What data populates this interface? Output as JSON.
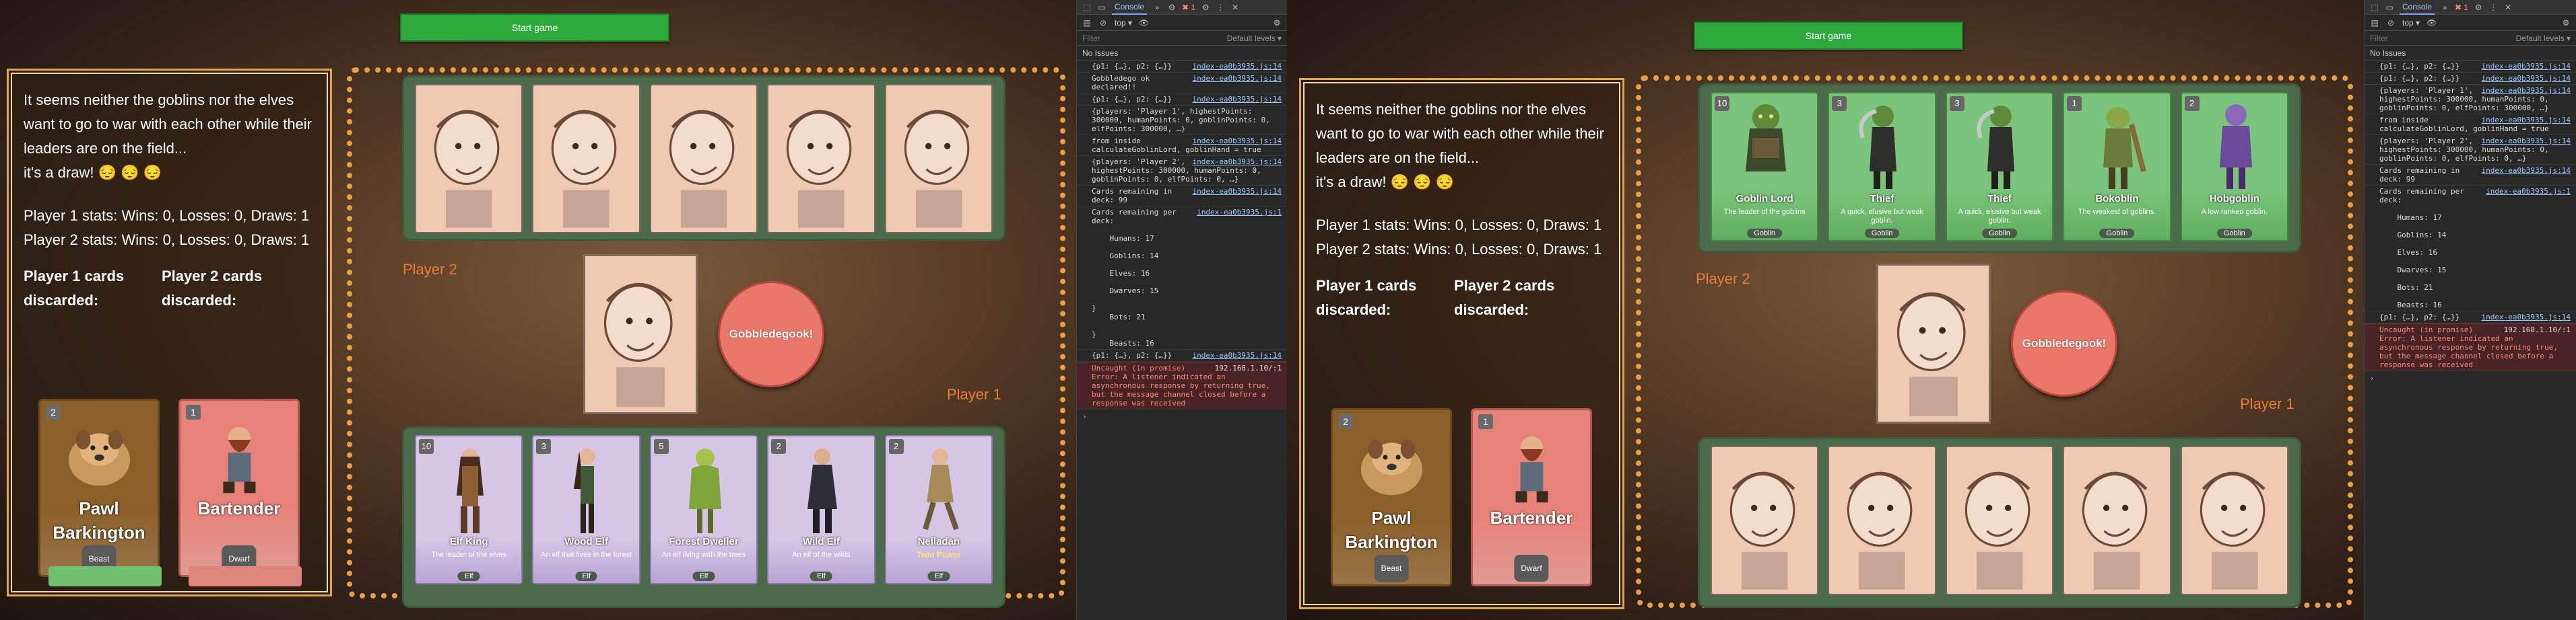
{
  "left": {
    "start_button": "Start game",
    "message": {
      "line1": "It seems neither the goblins nor the elves want to go to war with each other while their leaders are on the field...",
      "line2": "it's a draw! 😔 😔 😔",
      "p1_stats": "Player 1 stats: Wins: 0, Losses: 0, Draws: 1",
      "p2_stats": "Player 2 stats: Wins: 0, Losses: 0, Draws: 1",
      "p1_discard_title": "Player 1 cards discarded:",
      "p2_discard_title": "Player 2 cards discarded:"
    },
    "discarded": [
      {
        "cost": "2",
        "name": "Pawl Barkington",
        "tag": "Beast"
      },
      {
        "cost": "1",
        "name": "Bartender",
        "tag": "Dwarf"
      }
    ],
    "player2_label": "Player 2",
    "player1_label": "Player 1",
    "gobble_button": "Gobbledegook!",
    "elf_cards": [
      {
        "cost": "10",
        "name": "Elf King",
        "desc": "The leader of the elves",
        "tag": "Elf"
      },
      {
        "cost": "3",
        "name": "Wood Elf",
        "desc": "An elf that lives in the forest",
        "tag": "Elf"
      },
      {
        "cost": "5",
        "name": "Forest Dweller",
        "desc": "An elf living with the trees",
        "tag": "Elf"
      },
      {
        "cost": "2",
        "name": "Wild Elf",
        "desc": "An elf of the wilds",
        "tag": "Elf"
      },
      {
        "cost": "2",
        "name": "Nelladan",
        "desc": "Twin Power",
        "tag": "Elf"
      }
    ]
  },
  "right": {
    "start_button": "Start game",
    "message": {
      "line1": "It seems neither the goblins nor the elves want to go to war with each other while their leaders are on the field...",
      "line2": "it's a draw! 😔 😔 😔",
      "p1_stats": "Player 1 stats: Wins: 0, Losses: 0, Draws: 1",
      "p2_stats": "Player 2 stats: Wins: 0, Losses: 0, Draws: 1",
      "p1_discard_title": "Player 1 cards discarded:",
      "p2_discard_title": "Player 2 cards discarded:"
    },
    "discarded": [
      {
        "cost": "2",
        "name": "Pawl Barkington",
        "tag": "Beast"
      },
      {
        "cost": "1",
        "name": "Bartender",
        "tag": "Dwarf"
      }
    ],
    "player2_label": "Player 2",
    "player1_label": "Player 1",
    "gobble_button": "Gobbledegook!",
    "goblin_cards": [
      {
        "cost": "10",
        "name": "Goblin Lord",
        "desc": "The leader of the goblins",
        "tag": "Goblin"
      },
      {
        "cost": "3",
        "name": "Thief",
        "desc": "A quick, elusive but weak goblin.",
        "tag": "Goblin"
      },
      {
        "cost": "3",
        "name": "Thief",
        "desc": "A quick, elusive but weak goblin.",
        "tag": "Goblin"
      },
      {
        "cost": "1",
        "name": "Bokoblin",
        "desc": "The weakest of goblins.",
        "tag": "Goblin"
      },
      {
        "cost": "2",
        "name": "Hobgoblin",
        "desc": "A low ranked goblin.",
        "tag": "Goblin"
      }
    ]
  },
  "console_left": {
    "tab": "Console",
    "context": "top",
    "levels": "Default levels",
    "filter_placeholder": "Filter",
    "no_issues": "No Issues",
    "lines": [
      {
        "src": "index-ea0b3935.js:14",
        "text": "{p1: {…}, p2: {…}}"
      },
      {
        "src": "index-ea0b3935.js:14",
        "text": "Gobbledego ok declared!!"
      },
      {
        "src": "index-ea0b3935.js:14",
        "text": "{p1: {…}, p2: {…}}"
      },
      {
        "src": "",
        "text": "{players: 'Player 1', highestPoints: 300000, humanPoints: 0, goblinPoints: 0, elfPoints: 300000, …}"
      },
      {
        "src": "index-ea0b3935.js:14",
        "text": "from inside calculateGoblinLord, goblinHand = true"
      },
      {
        "src": "index-ea0b3935.js:14",
        "text": "{players: 'Player 2', highestPoints: 300000, humanPoints: 0, goblinPoints: 0, elfPoints: 0, …}"
      },
      {
        "src": "index-ea0b3935.js:14",
        "text": "Cards remaining in deck: 99"
      },
      {
        "src": "index-ea0b3935.js:1",
        "text": "Cards remaining per deck:\n\n    Humans: 17\n\n    Goblins: 14\n\n    Elves: 16\n\n    Dwarves: 15\n\n}\n    Bots: 21\n\n}\n    Beasts: 16"
      },
      {
        "src": "index-ea0b3935.js:14",
        "text": "{p1: {…}, p2: {…}}"
      }
    ],
    "error": {
      "src": "192.168.1.10/:1",
      "text": "Uncaught (in promise) Error: A listener indicated an asynchronous response by returning true, but the message channel closed before a response was received"
    }
  },
  "console_right": {
    "tab": "Console",
    "context": "top",
    "levels": "Default levels",
    "filter_placeholder": "Filter",
    "no_issues": "No Issues",
    "lines": [
      {
        "src": "index-ea0b3935.js:14",
        "text": "{p1: {…}, p2: {…}}"
      },
      {
        "src": "index-ea0b3935.js:14",
        "text": "{p1: {…}, p2: {…}}"
      },
      {
        "src": "index-ea0b3935.js:14",
        "text": "{players: 'Player 1', highestPoints: 300000, humanPoints: 0, goblinPoints: 0, elfPoints: 300000, …}"
      },
      {
        "src": "index-ea0b3935.js:14",
        "text": "from inside calculateGoblinLord, goblinHand = true"
      },
      {
        "src": "index-ea0b3935.js:14",
        "text": "{players: 'Player 2', highestPoints: 300000, humanPoints: 0, goblinPoints: 0, elfPoints: 0, …}"
      },
      {
        "src": "index-ea0b3935.js:14",
        "text": "Cards remaining in deck: 99"
      },
      {
        "src": "index-ea0b3935.js:1",
        "text": "Cards remaining per deck:\n\n    Humans: 17\n\n    Goblins: 14\n\n    Elves: 16\n\n    Dwarves: 15\n\n    Bots: 21\n\n    Beasts: 16"
      },
      {
        "src": "index-ea0b3935.js:14",
        "text": "{p1: {…}, p2: {…}}"
      }
    ],
    "error": {
      "src": "192.168.1.10/:1",
      "text": "Uncaught (in promise) Error: A listener indicated an asynchronous response by returning true, but the message channel closed before a response was received"
    }
  },
  "colors": {
    "accent_orange": "#e9a044",
    "start_green": "#2eaa3c",
    "gobble_red": "#e9786a",
    "elf_purple": "#d6c6e6",
    "goblin_green": "#7bc47b"
  },
  "error_count": "1"
}
